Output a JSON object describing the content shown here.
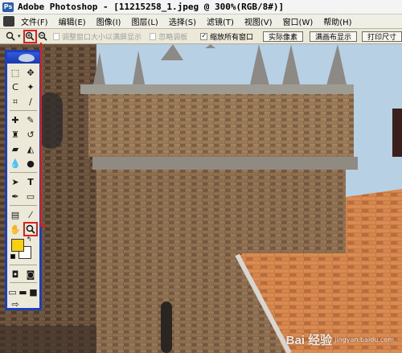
{
  "window": {
    "app_icon_text": "Ps",
    "title": "Adobe Photoshop - [11215258_1.jpeg @ 300%(RGB/8#)]"
  },
  "menu": {
    "items": [
      "文件(F)",
      "编辑(E)",
      "图像(I)",
      "图层(L)",
      "选择(S)",
      "滤镜(T)",
      "视图(V)",
      "窗口(W)",
      "帮助(H)"
    ]
  },
  "options": {
    "zoom_in_icon": "zoom-in-icon",
    "zoom_out_icon": "zoom-out-icon",
    "resize_windows_label": "调整窗口大小以满屏显示",
    "ignore_palettes_label": "忽略调板",
    "zoom_all_windows_label": "缩放所有窗口",
    "zoom_all_windows_checked": "✓",
    "actual_pixels_label": "实际像素",
    "fit_on_screen_label": "满画布显示",
    "print_size_label": "打印尺寸"
  },
  "toolbox": {
    "highlighted_tool": "zoom-tool",
    "foreground_color": "#f7d20c",
    "background_color": "#ffffff",
    "highlight_color": "#e02020",
    "frame_color": "#1c3fbf"
  },
  "watermark": {
    "text": "Bai 经验",
    "sub": "jingyan.baidu.com"
  }
}
